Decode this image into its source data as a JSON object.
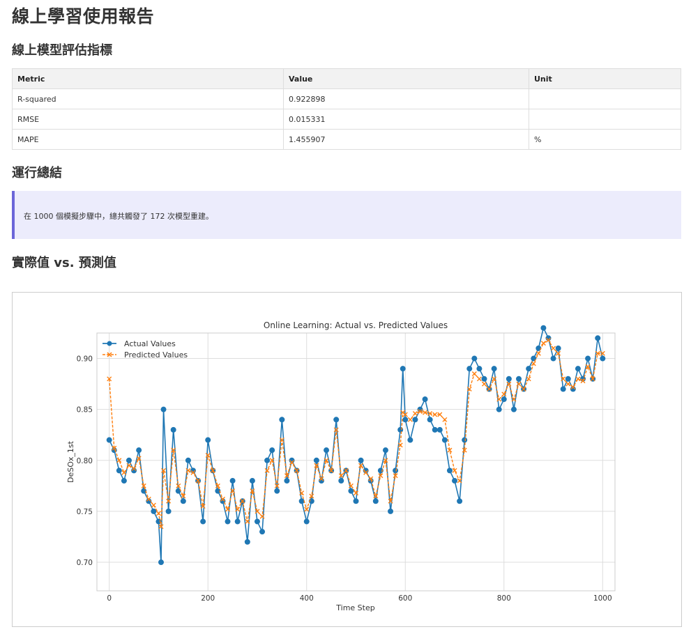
{
  "report": {
    "title": "線上學習使用報告",
    "metrics_heading": "線上模型評估指標",
    "summary_heading": "運行總結",
    "chart_heading": "實際值 vs. 預測值"
  },
  "metrics_table": {
    "headers": [
      "Metric",
      "Value",
      "Unit"
    ],
    "rows": [
      [
        "R-squared",
        "0.922898",
        ""
      ],
      [
        "RMSE",
        "0.015331",
        ""
      ],
      [
        "MAPE",
        "1.455907",
        "%"
      ]
    ]
  },
  "summary": {
    "text": "在 1000 個模擬步驟中，總共觸發了 172 次模型重建。"
  },
  "colors": {
    "actual": "#1f77b4",
    "predicted": "#ff7f0e",
    "grid": "#dddddd",
    "callout_border": "#6c66d9",
    "callout_bg": "#ececfc"
  },
  "chart_data": {
    "type": "line",
    "title": "Online Learning: Actual vs. Predicted Values",
    "xlabel": "Time Step",
    "ylabel": "DeSOx_1st",
    "xlim": [
      -25,
      1025
    ],
    "ylim": [
      0.672,
      0.925
    ],
    "xticks": [
      0,
      200,
      400,
      600,
      800,
      1000
    ],
    "yticks": [
      0.7,
      0.75,
      0.8,
      0.85,
      0.9
    ],
    "ytick_labels": [
      "0.70",
      "0.75",
      "0.80",
      "0.85",
      "0.90"
    ],
    "grid": true,
    "legend_position": "top-left",
    "series": [
      {
        "name": "Actual Values",
        "marker": "circle",
        "x": [
          0,
          10,
          20,
          30,
          40,
          50,
          60,
          70,
          80,
          90,
          100,
          105,
          110,
          120,
          130,
          140,
          150,
          160,
          170,
          180,
          190,
          200,
          210,
          220,
          230,
          240,
          250,
          260,
          270,
          280,
          290,
          300,
          310,
          320,
          330,
          340,
          350,
          360,
          370,
          380,
          390,
          400,
          410,
          420,
          430,
          440,
          450,
          460,
          470,
          480,
          490,
          500,
          510,
          520,
          530,
          540,
          550,
          560,
          570,
          580,
          590,
          595,
          600,
          610,
          620,
          630,
          640,
          650,
          660,
          670,
          680,
          690,
          700,
          710,
          720,
          730,
          740,
          750,
          760,
          770,
          780,
          790,
          800,
          810,
          820,
          830,
          840,
          850,
          860,
          870,
          880,
          890,
          900,
          910,
          920,
          930,
          940,
          950,
          960,
          970,
          980,
          990,
          1000
        ],
        "y": [
          0.82,
          0.81,
          0.79,
          0.78,
          0.8,
          0.79,
          0.81,
          0.77,
          0.76,
          0.75,
          0.74,
          0.7,
          0.85,
          0.75,
          0.83,
          0.77,
          0.76,
          0.8,
          0.79,
          0.78,
          0.74,
          0.82,
          0.79,
          0.77,
          0.76,
          0.74,
          0.78,
          0.74,
          0.76,
          0.72,
          0.78,
          0.74,
          0.73,
          0.8,
          0.81,
          0.77,
          0.84,
          0.78,
          0.8,
          0.79,
          0.76,
          0.74,
          0.76,
          0.8,
          0.78,
          0.81,
          0.79,
          0.84,
          0.78,
          0.79,
          0.77,
          0.76,
          0.8,
          0.79,
          0.78,
          0.76,
          0.79,
          0.81,
          0.75,
          0.79,
          0.83,
          0.89,
          0.84,
          0.82,
          0.84,
          0.85,
          0.86,
          0.84,
          0.83,
          0.83,
          0.82,
          0.79,
          0.78,
          0.76,
          0.82,
          0.89,
          0.9,
          0.89,
          0.88,
          0.87,
          0.89,
          0.85,
          0.86,
          0.88,
          0.85,
          0.88,
          0.87,
          0.89,
          0.9,
          0.91,
          0.93,
          0.92,
          0.9,
          0.91,
          0.87,
          0.88,
          0.87,
          0.89,
          0.88,
          0.9,
          0.88,
          0.92,
          0.9
        ]
      },
      {
        "name": "Predicted Values",
        "marker": "x",
        "x": [
          0,
          10,
          20,
          30,
          40,
          50,
          60,
          70,
          80,
          90,
          100,
          105,
          110,
          120,
          130,
          140,
          150,
          160,
          170,
          180,
          190,
          200,
          210,
          220,
          230,
          240,
          250,
          260,
          270,
          280,
          290,
          300,
          310,
          320,
          330,
          340,
          350,
          360,
          370,
          380,
          390,
          400,
          410,
          420,
          430,
          440,
          450,
          460,
          470,
          480,
          490,
          500,
          510,
          520,
          530,
          540,
          550,
          560,
          570,
          580,
          590,
          595,
          600,
          610,
          620,
          630,
          640,
          650,
          660,
          670,
          680,
          690,
          700,
          710,
          720,
          730,
          740,
          750,
          760,
          770,
          780,
          790,
          800,
          810,
          820,
          830,
          840,
          850,
          860,
          870,
          880,
          890,
          900,
          910,
          920,
          930,
          940,
          950,
          960,
          970,
          980,
          990,
          1000
        ],
        "y": [
          0.88,
          0.812,
          0.8,
          0.788,
          0.795,
          0.792,
          0.802,
          0.775,
          0.762,
          0.756,
          0.748,
          0.735,
          0.79,
          0.76,
          0.81,
          0.775,
          0.765,
          0.79,
          0.788,
          0.78,
          0.755,
          0.805,
          0.79,
          0.775,
          0.762,
          0.752,
          0.77,
          0.752,
          0.76,
          0.74,
          0.77,
          0.75,
          0.745,
          0.79,
          0.8,
          0.775,
          0.82,
          0.785,
          0.798,
          0.79,
          0.768,
          0.752,
          0.765,
          0.795,
          0.782,
          0.8,
          0.79,
          0.83,
          0.785,
          0.79,
          0.775,
          0.768,
          0.795,
          0.788,
          0.782,
          0.765,
          0.785,
          0.8,
          0.76,
          0.785,
          0.815,
          0.847,
          0.845,
          0.84,
          0.846,
          0.848,
          0.847,
          0.846,
          0.845,
          0.845,
          0.84,
          0.81,
          0.79,
          0.78,
          0.81,
          0.87,
          0.885,
          0.88,
          0.875,
          0.87,
          0.88,
          0.86,
          0.865,
          0.875,
          0.86,
          0.875,
          0.87,
          0.88,
          0.895,
          0.905,
          0.915,
          0.918,
          0.91,
          0.905,
          0.88,
          0.875,
          0.872,
          0.88,
          0.878,
          0.892,
          0.88,
          0.905,
          0.905
        ]
      }
    ]
  }
}
